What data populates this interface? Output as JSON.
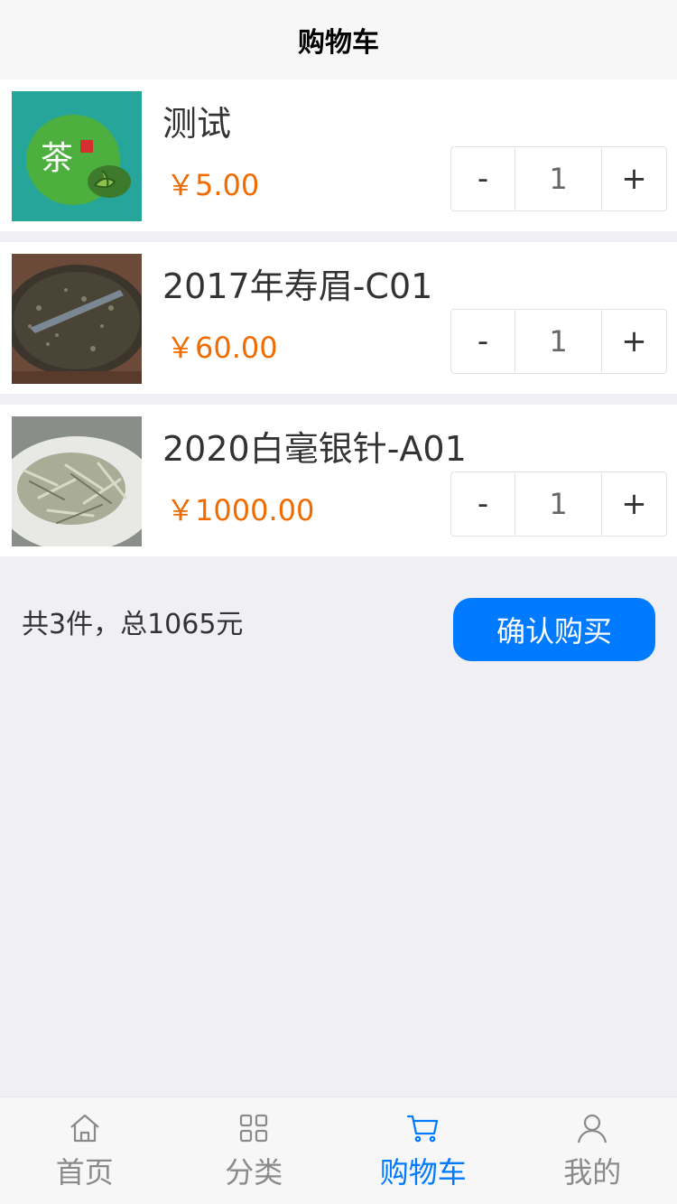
{
  "header": {
    "title": "购物车"
  },
  "cart": {
    "items": [
      {
        "name": "测试",
        "price": "￥5.00",
        "quantity": "1",
        "minus": "-",
        "plus": "+"
      },
      {
        "name": "2017年寿眉-C01",
        "price": "￥60.00",
        "quantity": "1",
        "minus": "-",
        "plus": "+"
      },
      {
        "name": "2020白毫银针-A01",
        "price": "￥1000.00",
        "quantity": "1",
        "minus": "-",
        "plus": "+"
      }
    ]
  },
  "footer": {
    "summary": "共3件，总1065元",
    "confirm_label": "确认购买",
    "accent": "#007aff",
    "price_color": "#f06b00"
  },
  "tabbar": {
    "items": [
      {
        "label": "首页",
        "icon": "home-icon",
        "active": false
      },
      {
        "label": "分类",
        "icon": "grid-icon",
        "active": false
      },
      {
        "label": "购物车",
        "icon": "cart-icon",
        "active": true
      },
      {
        "label": "我的",
        "icon": "person-icon",
        "active": false
      }
    ]
  }
}
